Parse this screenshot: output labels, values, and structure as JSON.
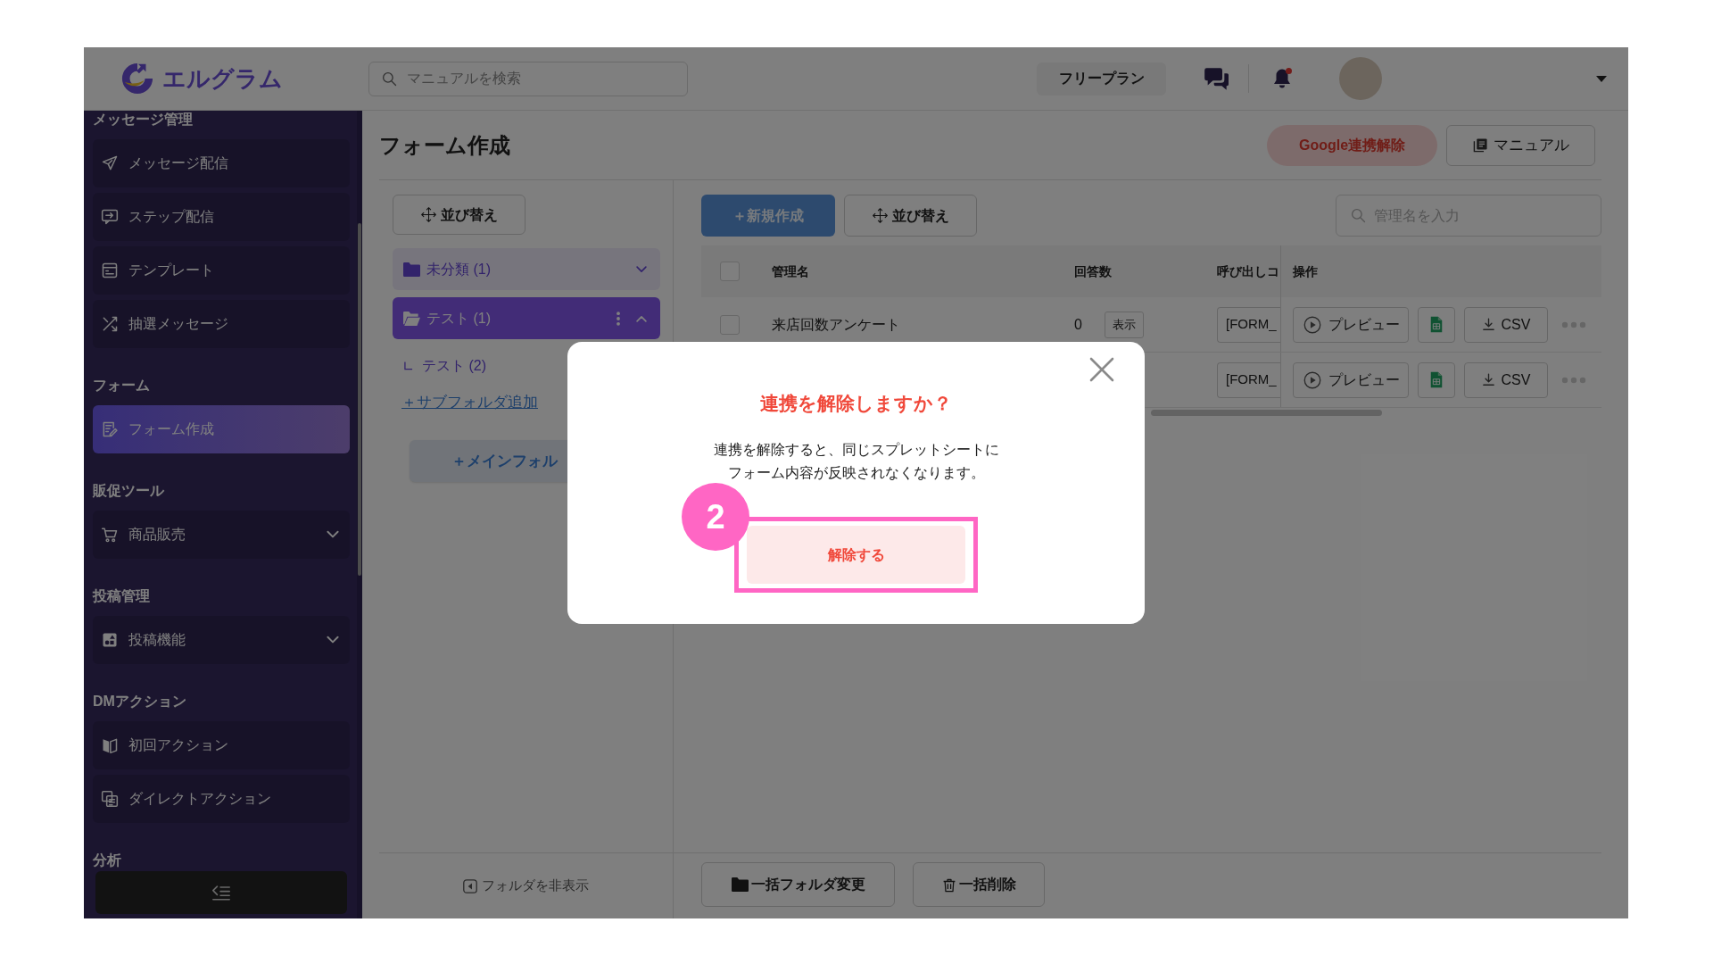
{
  "header": {
    "logo": "エルグラム",
    "search": {
      "placeholder": "マニュアルを検索"
    },
    "plan": "フリープラン",
    "has_notification": true
  },
  "sidebar": {
    "sections": [
      {
        "heading": "メッセージ管理",
        "items": [
          {
            "label": "メッセージ配信",
            "kind": "link",
            "selected": false
          },
          {
            "label": "ステップ配信",
            "kind": "link",
            "selected": false
          },
          {
            "label": "テンプレート",
            "kind": "link",
            "selected": false
          },
          {
            "label": "抽選メッセージ",
            "kind": "link",
            "selected": false
          }
        ]
      },
      {
        "heading": "フォーム",
        "items": [
          {
            "label": "フォーム作成",
            "kind": "link",
            "selected": true
          }
        ]
      },
      {
        "heading": "販促ツール",
        "items": [
          {
            "label": "商品販売",
            "kind": "group",
            "selected": false,
            "expanded": false
          }
        ]
      },
      {
        "heading": "投稿管理",
        "items": [
          {
            "label": "投稿機能",
            "kind": "group",
            "selected": false,
            "expanded": false
          }
        ]
      },
      {
        "heading": "DMアクション",
        "items": [
          {
            "label": "初回アクション",
            "kind": "link",
            "selected": false
          },
          {
            "label": "ダイレクトアクション",
            "kind": "link",
            "selected": false
          }
        ]
      },
      {
        "heading": "分析"
      }
    ]
  },
  "page": {
    "title": "フォーム作成",
    "actions": [
      {
        "label": "Google連携解除",
        "kind": "danger"
      },
      {
        "label": "マニュアル",
        "kind": "outline"
      }
    ]
  },
  "folders": {
    "sort_button": "並び替え",
    "items": [
      {
        "label": "未分類 (1)",
        "selected": false,
        "expanded": false
      },
      {
        "label": "テスト (1)",
        "selected": true,
        "expanded": true,
        "children": [
          {
            "label": "テスト (2)"
          }
        ]
      }
    ],
    "add_subfolder": "＋サブフォルダ追加",
    "add_main_folder": "＋メインフォル",
    "hide_folders": "フォルダを非表示"
  },
  "forms": {
    "new_button": "＋新規作成",
    "sort_button": "並び替え",
    "search": {
      "placeholder": "管理名を入力"
    },
    "table": {
      "select_all_checked": false,
      "columns": [
        "管理名",
        "回答数",
        "呼び出しコ",
        "操作"
      ],
      "rows": [
        {
          "checked": false,
          "name": "来店回数アンケート",
          "responses": "0",
          "show_button": "表示",
          "code": "[FORM_",
          "preview": "プレビュー",
          "csv": "CSV"
        },
        {
          "code": "[FORM_",
          "preview": "プレビュー",
          "csv": "CSV"
        }
      ]
    },
    "bulk_actions": [
      {
        "label": "一括フォルダ変更",
        "kind": "move"
      },
      {
        "label": "一括削除",
        "kind": "delete"
      }
    ]
  },
  "modal": {
    "title": "連携を解除しますか？",
    "message_lines": [
      "連携を解除すると、同じスプレットシートに",
      "フォーム内容が反映されなくなります。"
    ],
    "confirm_button": "解除する"
  },
  "annotation": {
    "step": "2"
  }
}
